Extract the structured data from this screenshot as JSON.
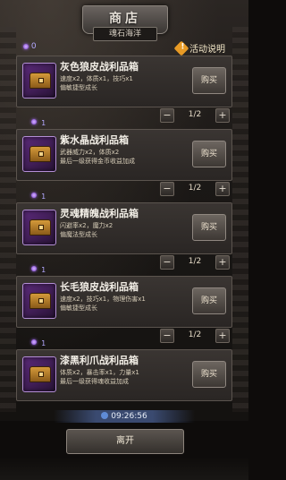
{
  "title": "商店",
  "subtitle": "魂石海洋",
  "currency": {
    "icon": "purple-gem-icon",
    "amount": "0"
  },
  "activity_label": "活动说明",
  "items": [
    {
      "name": "灰色狼皮战利品箱",
      "desc1": "速度x2，体质x1，技巧x1",
      "desc2": "偏敏捷型成长",
      "buy": "购买",
      "price": "1",
      "qty": "1/2",
      "minus": "−",
      "plus": "+"
    },
    {
      "name": "紫水晶战利品箱",
      "desc1": "武器威力x2，体质x2",
      "desc2": "最后一级获得金币收益加成",
      "buy": "购买",
      "price": "1",
      "qty": "1/2",
      "minus": "−",
      "plus": "+"
    },
    {
      "name": "灵魂精魄战利品箱",
      "desc1": "闪避率x2，魔力x2",
      "desc2": "偏魔法型成长",
      "buy": "购买",
      "price": "1",
      "qty": "1/2",
      "minus": "−",
      "plus": "+"
    },
    {
      "name": "长毛狼皮战利品箱",
      "desc1": "速度x2，技巧x1，物理伤害x1",
      "desc2": "偏敏捷型成长",
      "buy": "购买",
      "price": "1",
      "qty": "1/2",
      "minus": "−",
      "plus": "+"
    },
    {
      "name": "漆黑利爪战利品箱",
      "desc1": "体质x2，暴击率x1，力量x1",
      "desc2": "最后一级获得魂收益加成",
      "buy": "购买"
    }
  ],
  "timer": "09:26:56",
  "leave_label": "离开",
  "colors": {
    "accent": "#e79a25",
    "gem": "#a56bff"
  }
}
